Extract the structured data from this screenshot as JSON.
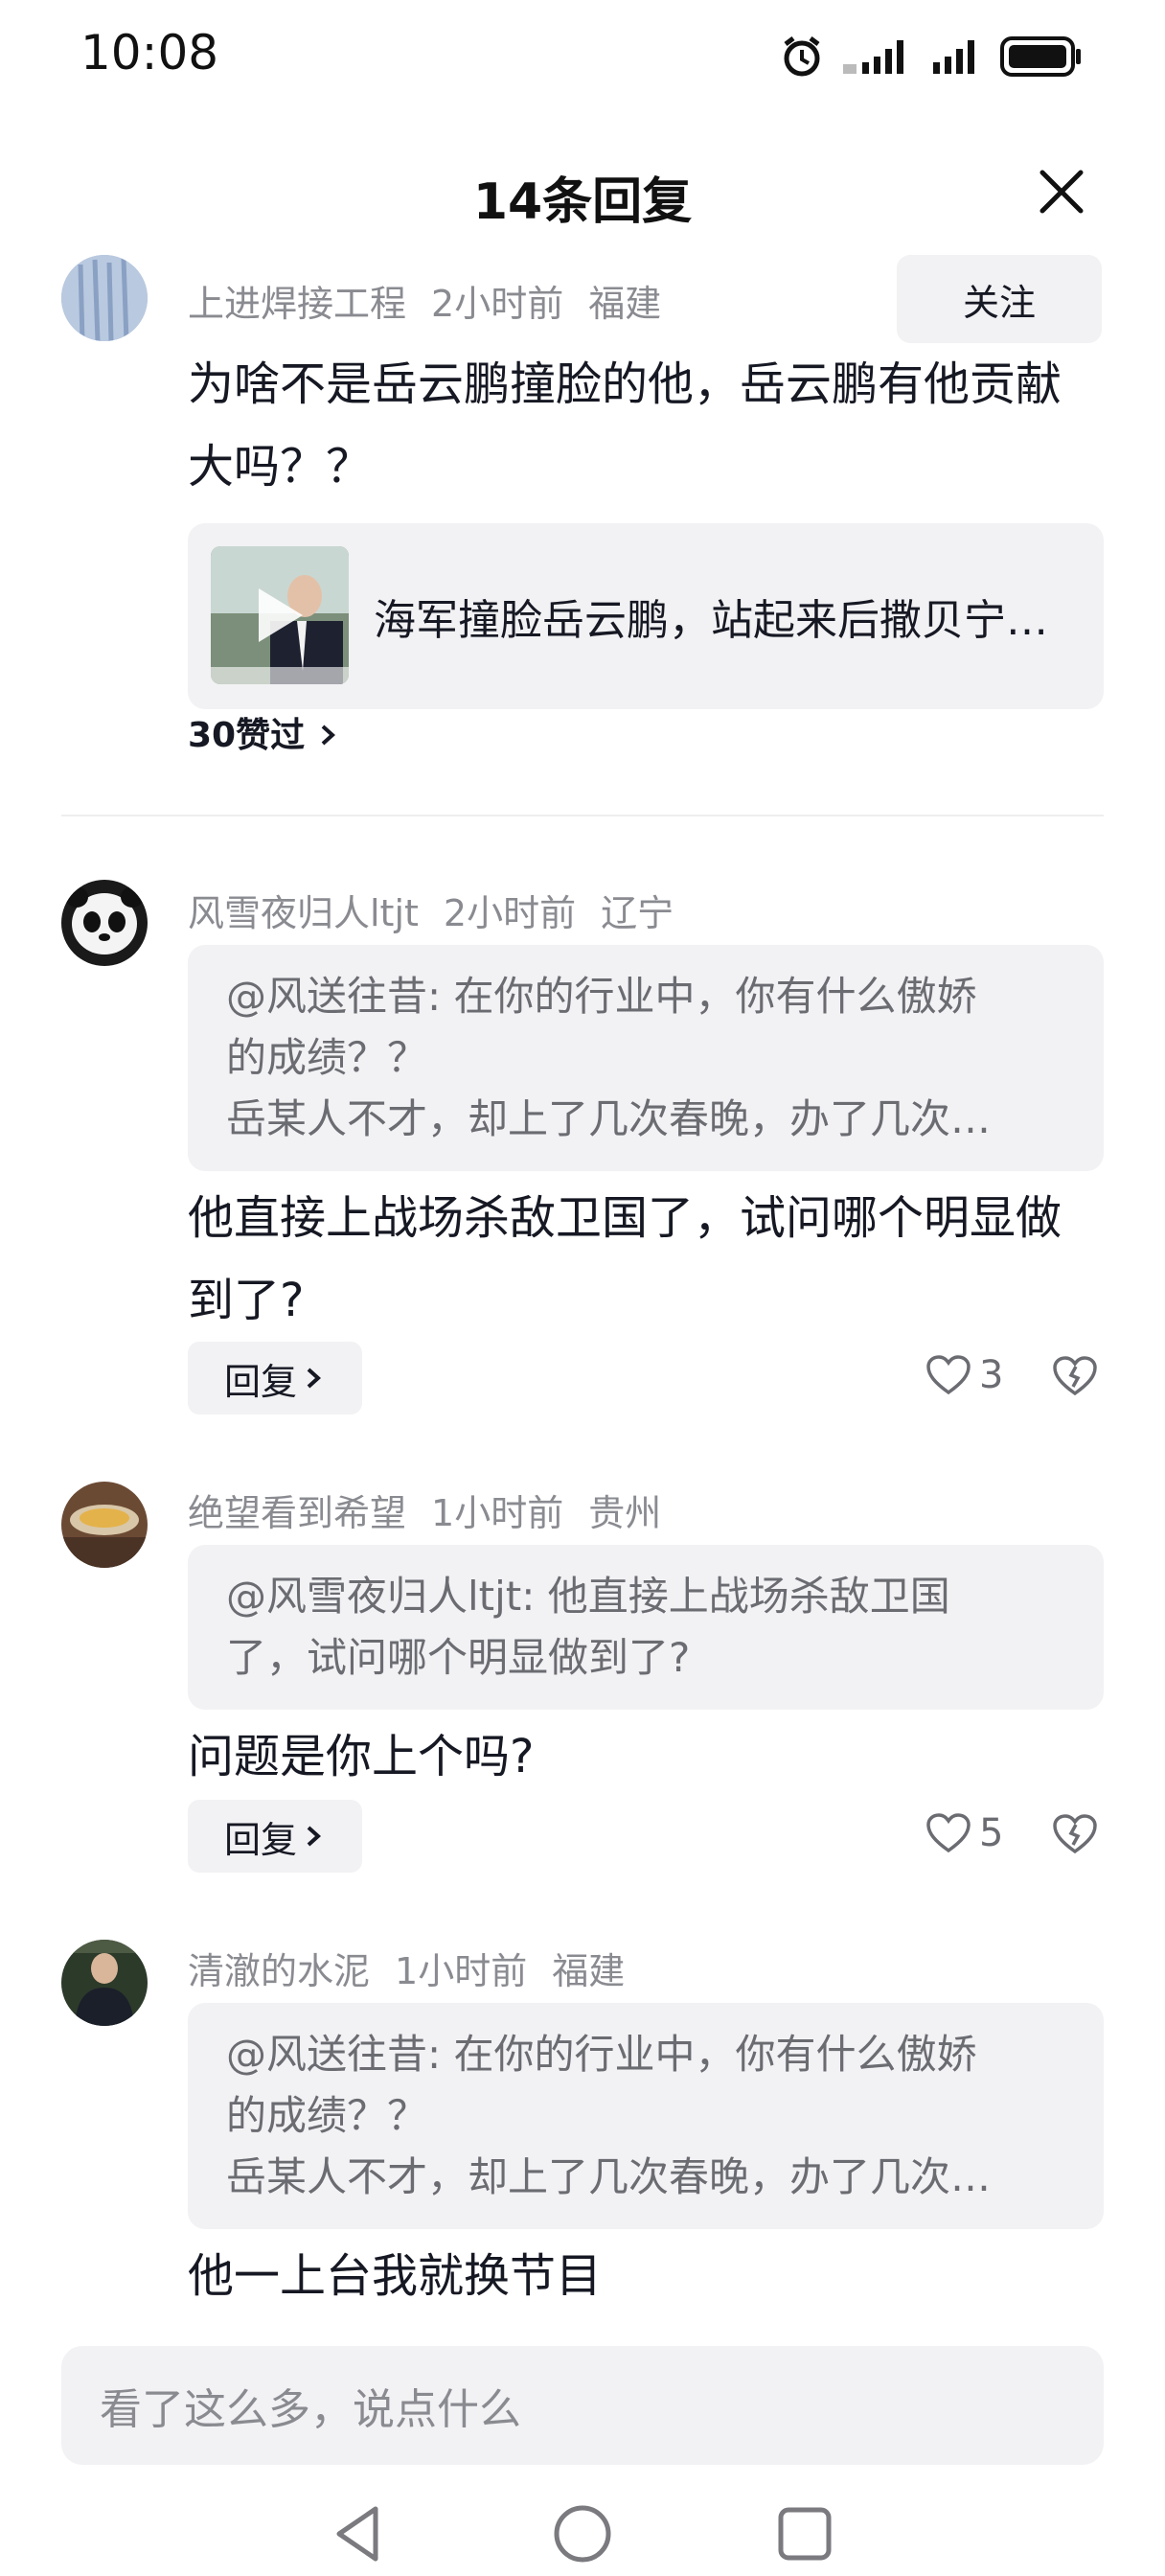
{
  "status_bar": {
    "time": "10:08"
  },
  "header": {
    "title": "14条回复"
  },
  "main_comment": {
    "username": "上进焊接工程",
    "time": "2小时前",
    "location": "福建",
    "follow_label": "关注",
    "text_line1": "为啥不是岳云鹏撞脸的他，岳云鹏有他贡献",
    "text_line2": "大吗？？",
    "video_title": "海军撞脸岳云鹏，站起来后撒贝宁…",
    "likes_link": "30赞过"
  },
  "replies": [
    {
      "username": "风雪夜归人ltjt",
      "time": "2小时前",
      "location": "辽宁",
      "quote_lines": [
        "@风送往昔: 在你的行业中，你有什么傲娇",
        "的成绩？？",
        "岳某人不才，却上了几次春晚，办了几次…"
      ],
      "text_lines": [
        "他直接上战场杀敌卫国了，试问哪个明显做",
        "到了?"
      ],
      "reply_label": "回复",
      "like_count": "3"
    },
    {
      "username": "绝望看到希望",
      "time": "1小时前",
      "location": "贵州",
      "quote_lines": [
        "@风雪夜归人ltjt: 他直接上战场杀敌卫国",
        "了，试问哪个明显做到了?"
      ],
      "text_lines": [
        "问题是你上个吗?"
      ],
      "reply_label": "回复",
      "like_count": "5"
    },
    {
      "username": "清澈的水泥",
      "time": "1小时前",
      "location": "福建",
      "quote_lines": [
        "@风送往昔: 在你的行业中，你有什么傲娇",
        "的成绩？？",
        "岳某人不才，却上了几次春晚，办了几次…"
      ],
      "text_lines": [
        "他一上台我就换节目"
      ]
    }
  ],
  "input": {
    "placeholder": "看了这么多，说点什么"
  },
  "icons": {
    "close": "close-icon",
    "heart": "heart-icon",
    "dislike": "broken-heart-icon",
    "chevron": "chevron-right-icon",
    "play": "play-icon",
    "nav_back": "back-triangle-icon",
    "nav_home": "home-circle-icon",
    "nav_recent": "recent-square-icon"
  }
}
